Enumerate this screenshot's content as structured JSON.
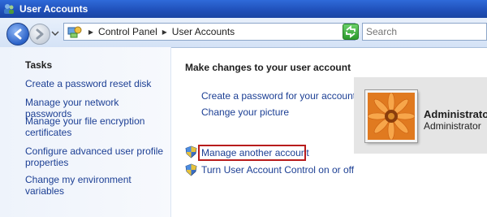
{
  "window": {
    "title": "User Accounts"
  },
  "navigation": {
    "breadcrumb": [
      "Control Panel",
      "User Accounts"
    ],
    "separator": "▸",
    "search_placeholder": "Search"
  },
  "sidebar": {
    "heading": "Tasks",
    "items": [
      "Create a password reset disk",
      "Manage your network passwords",
      "Manage your file encryption certificates",
      "Configure advanced user profile properties",
      "Change my environment variables"
    ]
  },
  "main": {
    "heading": "Make changes to your user account",
    "links": [
      "Create a password for your account",
      "Change your picture"
    ],
    "shield_links": [
      "Manage another account",
      "Turn User Account Control on or off"
    ]
  },
  "user": {
    "name": "Administrator",
    "role": "Administrator"
  },
  "colors": {
    "link": "#1c3f94",
    "highlight": "#b81c1c",
    "titlebar": "#2a5dc8"
  }
}
